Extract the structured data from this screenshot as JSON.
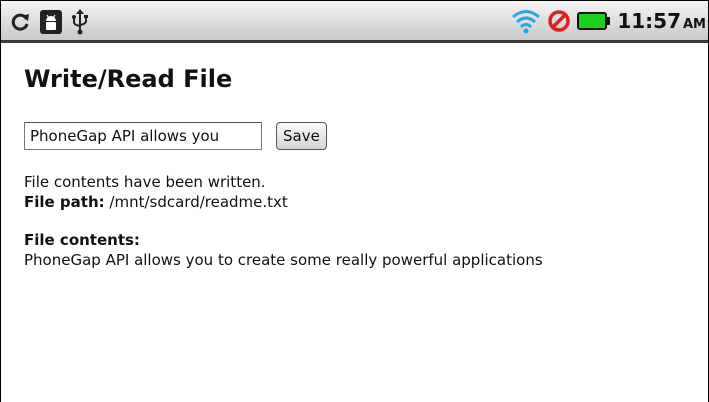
{
  "status_bar": {
    "left_icons": [
      "sync-icon",
      "android-debug-icon",
      "usb-icon"
    ],
    "right_icons": [
      "wifi-icon",
      "no-signal-icon",
      "battery-icon"
    ],
    "time": "11:57",
    "ampm": "AM",
    "colors": {
      "wifi": "#2aa7e0",
      "no_signal": "#e02020",
      "battery": "#1bd11b"
    }
  },
  "page": {
    "title": "Write/Read File"
  },
  "form": {
    "input_value": "PhoneGap API allows you",
    "save_label": "Save"
  },
  "status": {
    "message": "File contents have been written.",
    "path_label": "File path:",
    "path_value": " /mnt/sdcard/readme.txt"
  },
  "contents": {
    "label": "File contents:",
    "text": "PhoneGap API allows you to create some really powerful applications"
  }
}
